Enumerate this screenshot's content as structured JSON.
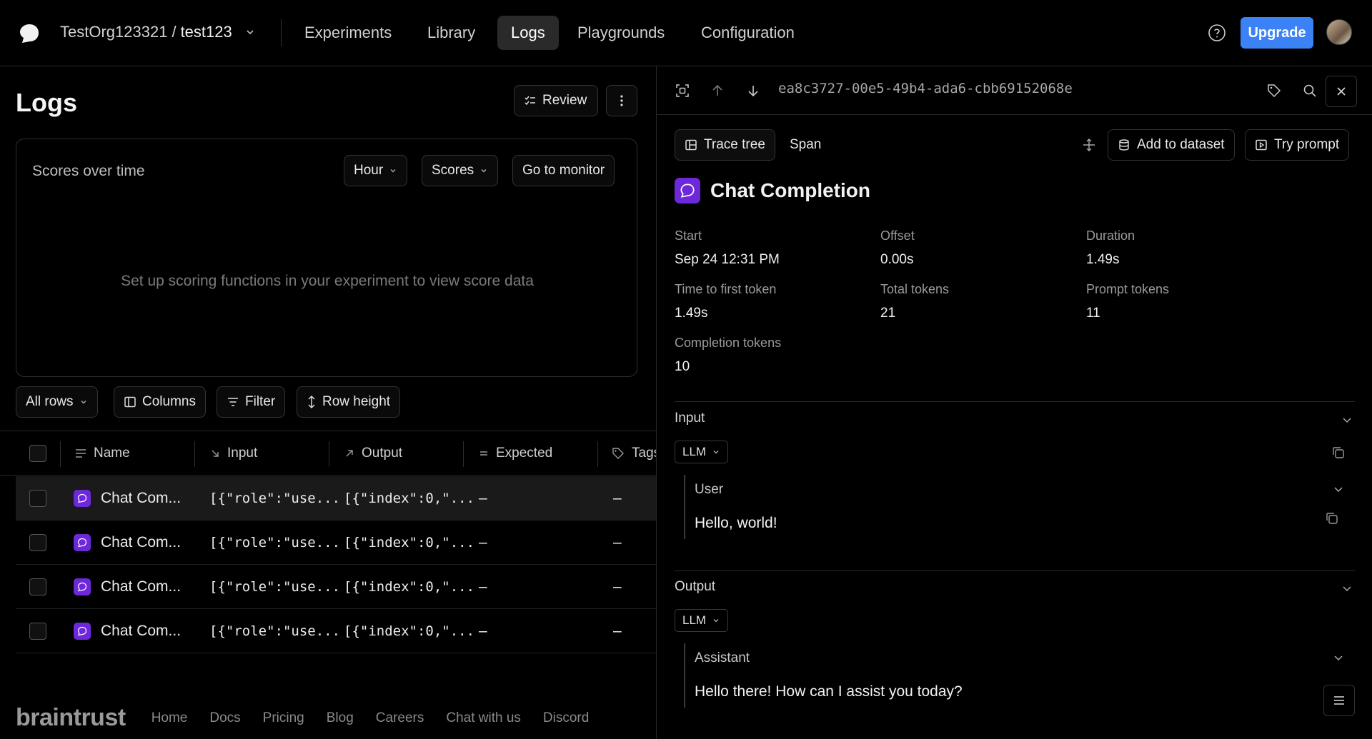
{
  "nav": {
    "org": "TestOrg123321",
    "separator": "/",
    "project": "test123",
    "items": [
      "Experiments",
      "Library",
      "Logs",
      "Playgrounds",
      "Configuration"
    ],
    "active": "Logs",
    "upgrade_label": "Upgrade",
    "accent": "#3b82f6"
  },
  "logs": {
    "title": "Logs",
    "review_label": "Review",
    "chart": {
      "title": "Scores over time",
      "hour_label": "Hour",
      "scores_label": "Scores",
      "monitor_label": "Go to monitor",
      "empty_message": "Set up scoring functions in your experiment to view score data"
    },
    "toolbar": {
      "all_rows": "All rows",
      "columns": "Columns",
      "filter": "Filter",
      "row_height": "Row height"
    },
    "columns": [
      "Name",
      "Input",
      "Output",
      "Expected",
      "Tags"
    ],
    "rows": [
      {
        "name": "Chat Com...",
        "input": "[{\"role\":\"use...",
        "output": "[{\"index\":0,\"...",
        "expected": "–",
        "tags": "–"
      },
      {
        "name": "Chat Com...",
        "input": "[{\"role\":\"use...",
        "output": "[{\"index\":0,\"...",
        "expected": "–",
        "tags": "–"
      },
      {
        "name": "Chat Com...",
        "input": "[{\"role\":\"use...",
        "output": "[{\"index\":0,\"...",
        "expected": "–",
        "tags": "–"
      },
      {
        "name": "Chat Com...",
        "input": "[{\"role\":\"use...",
        "output": "[{\"index\":0,\"...",
        "expected": "–",
        "tags": "–"
      }
    ]
  },
  "footer": {
    "brand": "braintrust",
    "links": [
      "Home",
      "Docs",
      "Pricing",
      "Blog",
      "Careers",
      "Chat with us",
      "Discord"
    ]
  },
  "detail": {
    "trace_id": "ea8c3727-00e5-49b4-ada6-cbb69152068e",
    "trace_tree_label": "Trace tree",
    "span_label": "Span",
    "add_dataset_label": "Add to dataset",
    "try_prompt_label": "Try prompt",
    "span_title": "Chat Completion",
    "metrics": [
      {
        "label": "Start",
        "value": "Sep 24 12:31 PM"
      },
      {
        "label": "Offset",
        "value": "0.00s"
      },
      {
        "label": "Duration",
        "value": "1.49s"
      },
      {
        "label": "Time to first token",
        "value": "1.49s"
      },
      {
        "label": "Total tokens",
        "value": "21"
      },
      {
        "label": "Prompt tokens",
        "value": "11"
      },
      {
        "label": "Completion tokens",
        "value": "10"
      }
    ],
    "input": {
      "title": "Input",
      "format": "LLM",
      "role": "User",
      "text": "Hello, world!"
    },
    "output": {
      "title": "Output",
      "format": "LLM",
      "role": "Assistant",
      "text": "Hello there! How can I assist you today?"
    },
    "span_color": "#6d28d9"
  }
}
